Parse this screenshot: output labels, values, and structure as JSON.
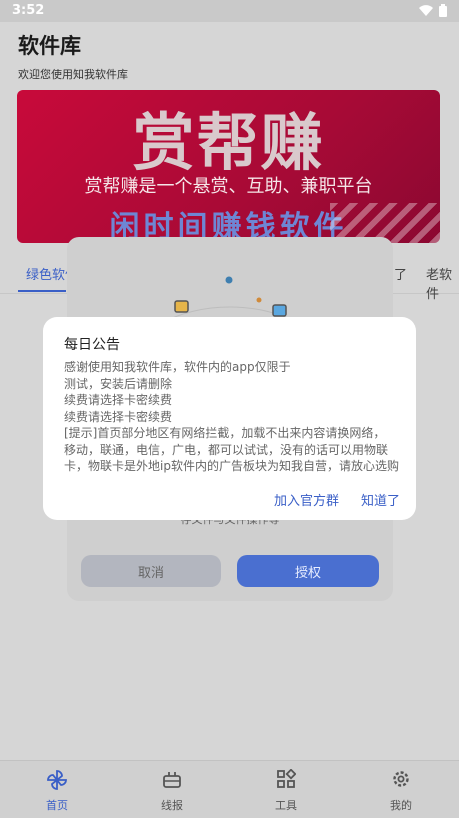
{
  "status_bar": {
    "time": "3:52"
  },
  "header": {
    "title": "软件库",
    "subtitle": "欢迎您使用知我软件库"
  },
  "banner": {
    "headline": "赏帮赚",
    "tagline": "赏帮赚是一个悬赏、互助、兼职平台",
    "slogan": "闲时间赚钱软件"
  },
  "tabs": [
    {
      "label": "绿色软件"
    },
    {
      "label": "了"
    },
    {
      "label": "老软件"
    }
  ],
  "permission_dialog": {
    "description": "存文件与文件操作等",
    "cancel_label": "取消",
    "authorize_label": "授权"
  },
  "notice_dialog": {
    "title": "每日公告",
    "lines": [
      "感谢使用知我软件库，软件内的app仅限于",
      "测试，安装后请删除",
      "续费请选择卡密续费",
      "续费请选择卡密续费",
      "[提示]首页部分地区有网络拦截，加载不出来内容请换网络，",
      "移动，联通，电信，广电，都可以试试，没有的话可以用物联",
      "卡，物联卡是外地ip软件内的广告板块为知我自营，请放心选购"
    ],
    "join_group_label": "加入官方群",
    "ok_label": "知道了"
  },
  "bottom_nav": [
    {
      "label": "首页",
      "icon": "pinwheel-icon"
    },
    {
      "label": "线报",
      "icon": "cake-icon"
    },
    {
      "label": "工具",
      "icon": "tools-grid-icon"
    },
    {
      "label": "我的",
      "icon": "gear-icon"
    }
  ],
  "colors": {
    "accent": "#3a5fc7",
    "banner_red": "#c80a3a"
  }
}
